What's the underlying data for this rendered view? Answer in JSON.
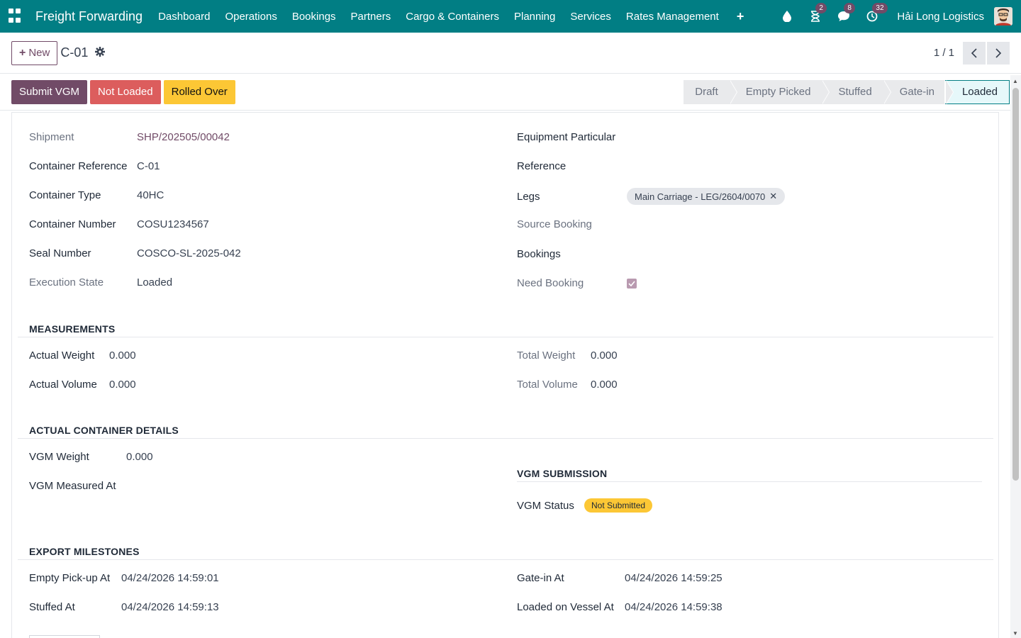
{
  "nav": {
    "brand": "Freight Forwarding",
    "menu": [
      "Dashboard",
      "Operations",
      "Bookings",
      "Partners",
      "Cargo & Containers",
      "Planning",
      "Services",
      "Rates Management"
    ],
    "plus": "+",
    "badges": {
      "activity": "2",
      "messages": "8",
      "updates": "32"
    },
    "company": "Hải Long Logistics"
  },
  "control": {
    "new_label": "New",
    "record_title": "C-01",
    "pager": "1 / 1"
  },
  "statusbar": {
    "buttons": {
      "submit_vgm": "Submit VGM",
      "not_loaded": "Not Loaded",
      "rolled_over": "Rolled Over"
    },
    "stages": [
      "Draft",
      "Empty Picked",
      "Stuffed",
      "Gate-in",
      "Loaded"
    ],
    "active_stage": "Loaded"
  },
  "form": {
    "left": {
      "shipment": {
        "label": "Shipment",
        "value": "SHP/202505/00042"
      },
      "container_reference": {
        "label": "Container Reference",
        "value": "C-01"
      },
      "container_type": {
        "label": "Container Type",
        "value": "40HC"
      },
      "container_number": {
        "label": "Container Number",
        "value": "COSU1234567"
      },
      "seal_number": {
        "label": "Seal Number",
        "value": "COSCO-SL-2025-042"
      },
      "execution_state": {
        "label": "Execution State",
        "value": "Loaded"
      }
    },
    "right": {
      "equipment_particular": {
        "label": "Equipment Particular",
        "value": ""
      },
      "reference": {
        "label": "Reference",
        "value": ""
      },
      "legs": {
        "label": "Legs",
        "tag": "Main Carriage - LEG/2604/0070"
      },
      "source_booking": {
        "label": "Source Booking",
        "value": ""
      },
      "bookings": {
        "label": "Bookings",
        "value": ""
      },
      "need_booking": {
        "label": "Need Booking",
        "checked": true
      }
    },
    "measurements": {
      "title": "MEASUREMENTS",
      "actual_weight": {
        "label": "Actual Weight",
        "value": "0.000"
      },
      "actual_volume": {
        "label": "Actual Volume",
        "value": "0.000"
      },
      "total_weight": {
        "label": "Total Weight",
        "value": "0.000"
      },
      "total_volume": {
        "label": "Total Volume",
        "value": "0.000"
      }
    },
    "actual_container": {
      "title": "ACTUAL CONTAINER DETAILS",
      "vgm_weight": {
        "label": "VGM Weight",
        "value": "0.000"
      },
      "vgm_measured_at": {
        "label": "VGM Measured At",
        "value": ""
      }
    },
    "vgm_submission": {
      "title": "VGM SUBMISSION",
      "vgm_status": {
        "label": "VGM Status",
        "value": "Not Submitted"
      }
    },
    "export_milestones": {
      "title": "EXPORT MILESTONES",
      "empty_pickup_at": {
        "label": "Empty Pick-up At",
        "value": "04/24/2026 14:59:01"
      },
      "stuffed_at": {
        "label": "Stuffed At",
        "value": "04/24/2026 14:59:13"
      },
      "gate_in_at": {
        "label": "Gate-in At",
        "value": "04/24/2026 14:59:25"
      },
      "loaded_on_vessel_at": {
        "label": "Loaded on Vessel At",
        "value": "04/24/2026 14:59:38"
      }
    }
  },
  "colors": {
    "navbar": "#017e84",
    "primary": "#714b67",
    "danger": "#dc5d5d",
    "warning": "#fcc735"
  }
}
